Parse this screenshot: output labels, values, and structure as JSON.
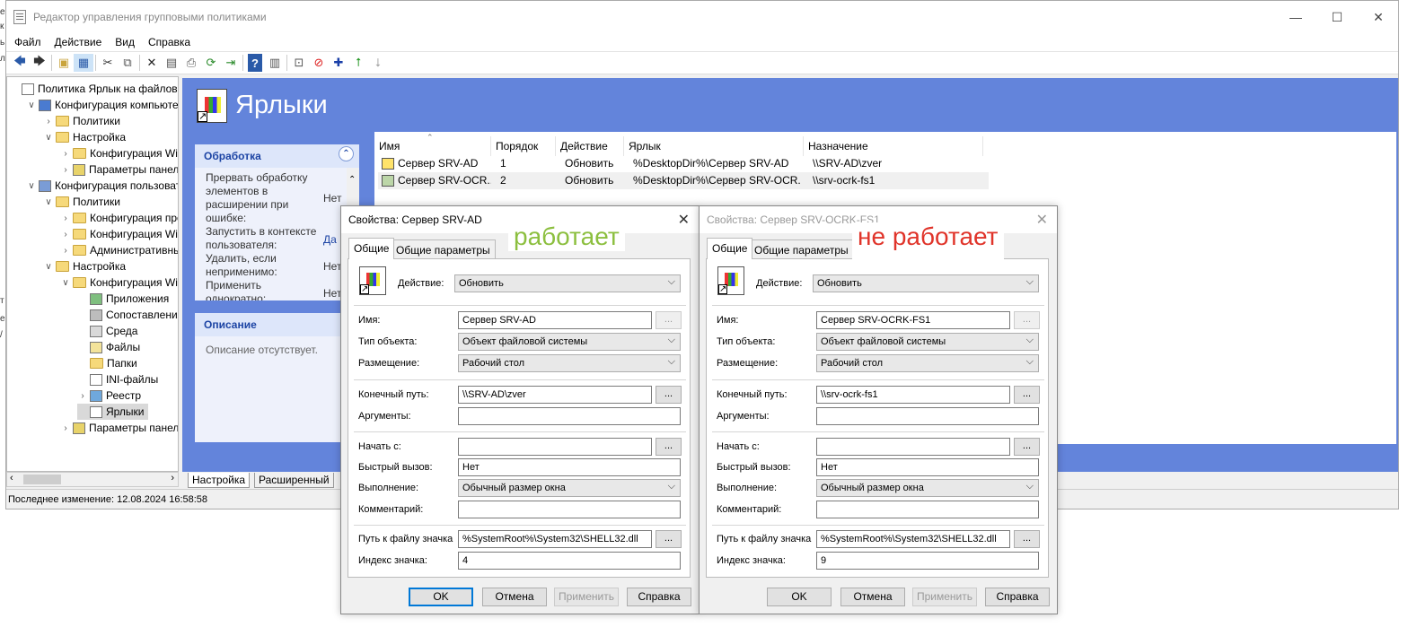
{
  "window": {
    "title": "Редактор управления групповыми политиками",
    "controls": {
      "minimize": "—",
      "maximize": "☐",
      "close": "✕"
    }
  },
  "menu": [
    "Файл",
    "Действие",
    "Вид",
    "Справка"
  ],
  "tree": [
    {
      "label": "Политика Ярлык на файловый",
      "indent": 0,
      "arrow": "",
      "icon": "gpo"
    },
    {
      "label": "Конфигурация компьютер",
      "indent": 1,
      "arrow": "∨",
      "icon": "computer"
    },
    {
      "label": "Политики",
      "indent": 2,
      "arrow": "›",
      "icon": "folder"
    },
    {
      "label": "Настройка",
      "indent": 2,
      "arrow": "∨",
      "icon": "folder"
    },
    {
      "label": "Конфигурация Wind",
      "indent": 3,
      "arrow": "›",
      "icon": "folder"
    },
    {
      "label": "Параметры панели",
      "indent": 3,
      "arrow": "›",
      "icon": "panel"
    },
    {
      "label": "Конфигурация пользовате",
      "indent": 1,
      "arrow": "∨",
      "icon": "user"
    },
    {
      "label": "Политики",
      "indent": 2,
      "arrow": "∨",
      "icon": "folder"
    },
    {
      "label": "Конфигурация прог",
      "indent": 3,
      "arrow": "›",
      "icon": "folder"
    },
    {
      "label": "Конфигурация Wind",
      "indent": 3,
      "arrow": "›",
      "icon": "folder"
    },
    {
      "label": "Административные",
      "indent": 3,
      "arrow": "›",
      "icon": "folder"
    },
    {
      "label": "Настройка",
      "indent": 2,
      "arrow": "∨",
      "icon": "folder"
    },
    {
      "label": "Конфигурация Wind",
      "indent": 3,
      "arrow": "∨",
      "icon": "folder"
    },
    {
      "label": "Приложения",
      "indent": 4,
      "arrow": "",
      "icon": "apps"
    },
    {
      "label": "Сопоставления д",
      "indent": 4,
      "arrow": "",
      "icon": "drive"
    },
    {
      "label": "Среда",
      "indent": 4,
      "arrow": "",
      "icon": "env"
    },
    {
      "label": "Файлы",
      "indent": 4,
      "arrow": "",
      "icon": "files"
    },
    {
      "label": "Папки",
      "indent": 4,
      "arrow": "",
      "icon": "folder"
    },
    {
      "label": "INI-файлы",
      "indent": 4,
      "arrow": "",
      "icon": "ini"
    },
    {
      "label": "Реестр",
      "indent": 4,
      "arrow": "›",
      "icon": "registry"
    },
    {
      "label": "Ярлыки",
      "indent": 4,
      "arrow": "",
      "icon": "shortcut",
      "selected": true
    },
    {
      "label": "Параметры панели",
      "indent": 3,
      "arrow": "›",
      "icon": "panel"
    }
  ],
  "content": {
    "title": "Ярлыки",
    "processing_panel": {
      "heading": "Обработка",
      "items": [
        {
          "label": "Прервать обработку элементов в расширении при ошибке:",
          "value": "Нет"
        },
        {
          "label": "Запустить в контексте пользователя:",
          "value": "Да"
        },
        {
          "label": "Удалить, если неприменимо:",
          "value": "Нет"
        },
        {
          "label": "Применить однократно:",
          "value": "Нет"
        }
      ]
    },
    "description_panel": {
      "heading": "Описание",
      "text": "Описание отсутствует."
    },
    "list": {
      "columns": [
        "Имя",
        "Порядок",
        "Действие",
        "Ярлык",
        "Назначение"
      ],
      "rows": [
        [
          "Сервер SRV-AD",
          "1",
          "Обновить",
          "%DesktopDir%\\Сервер SRV-AD",
          "\\\\SRV-AD\\zver"
        ],
        [
          "Сервер SRV-OCR...",
          "2",
          "Обновить",
          "%DesktopDir%\\Сервер SRV-OCR...",
          "\\\\srv-ocrk-fs1"
        ]
      ]
    },
    "bottom_tabs": [
      "Настройка",
      "Расширенный"
    ]
  },
  "status": "Последнее изменение: 12.08.2024 16:58:58",
  "dialog_labels": {
    "tabs": [
      "Общие",
      "Общие параметры"
    ],
    "action": "Действие:",
    "name": "Имя:",
    "object_type": "Тип объекта:",
    "location": "Размещение:",
    "target": "Конечный путь:",
    "arguments": "Аргументы:",
    "start_in": "Начать с:",
    "hotkey": "Быстрый вызов:",
    "run": "Выполнение:",
    "comment": "Комментарий:",
    "icon_path": "Путь к файлу значка",
    "icon_index": "Индекс значка:",
    "buttons": [
      "OK",
      "Отмена",
      "Применить",
      "Справка"
    ],
    "browse": "..."
  },
  "dialog1": {
    "title": "Свойства: Сервер SRV-AD",
    "annotation": "работает",
    "annotation_color": "#8cbf3f",
    "action": "Обновить",
    "name": "Сервер SRV-AD",
    "object_type": "Объект файловой системы",
    "location": "Рабочий стол",
    "target": "\\\\SRV-AD\\zver",
    "arguments": "",
    "start_in": "",
    "hotkey": "Нет",
    "run": "Обычный размер окна",
    "comment": "",
    "icon_path": "%SystemRoot%\\System32\\SHELL32.dll",
    "icon_index": "4"
  },
  "dialog2": {
    "title": "Свойства: Сервер SRV-OCRK-FS1",
    "annotation": "не работает",
    "annotation_color": "#e0342a",
    "action": "Обновить",
    "name": "Сервер SRV-OCRK-FS1",
    "object_type": "Объект файловой системы",
    "location": "Рабочий стол",
    "target": "\\\\srv-ocrk-fs1",
    "arguments": "",
    "start_in": "",
    "hotkey": "Нет",
    "run": "Обычный размер окна",
    "comment": "",
    "icon_path": "%SystemRoot%\\System32\\SHELL32.dll",
    "icon_index": "9"
  }
}
